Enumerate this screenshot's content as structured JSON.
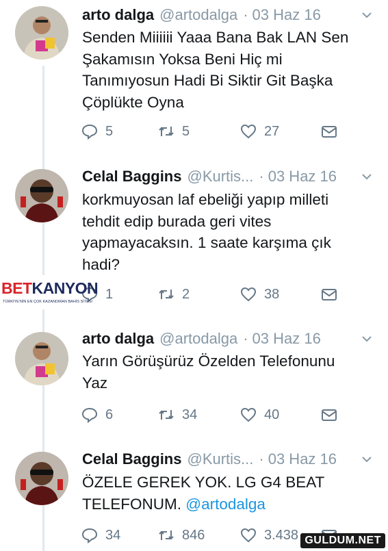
{
  "tweets": [
    {
      "name": "arto dalga",
      "handle": "@artodalga",
      "date": "03 Haz 16",
      "text_lines": [
        "Senden Miiiiii Yaaa Bana Bak LAN Sen",
        "Şakamısın Yoksa Beni Hiç mi",
        "Tanımıyosun Hadi Bi Siktir Git Başka",
        "Çöplükte Oyna"
      ],
      "replies": "5",
      "retweets": "5",
      "likes": "27"
    },
    {
      "name": "Celal Baggins",
      "handle": "@Kurtis...",
      "date": "03 Haz 16",
      "text_lines": [
        "korkmuyosan laf ebeliği yapıp milleti",
        "tehdit edip burada geri vites",
        "yapmayacaksın. 1 saate karşıma çık",
        "hadi?"
      ],
      "replies": "1",
      "retweets": "2",
      "likes": "38"
    },
    {
      "name": "arto dalga",
      "handle": "@artodalga",
      "date": "03 Haz 16",
      "text_lines": [
        "Yarın Görüşürüz Özelden Telefonunu",
        "Yaz"
      ],
      "replies": "6",
      "retweets": "34",
      "likes": "40"
    },
    {
      "name": "Celal Baggins",
      "handle": "@Kurtis...",
      "date": "03 Haz 16",
      "text_lines": [
        "ÖZELE GEREK YOK. LG G4 BEAT"
      ],
      "text_line2": "TELEFONUM.",
      "mention": "@artodalga",
      "replies": "34",
      "retweets": "846",
      "likes": "3.438"
    }
  ],
  "ad_logo": {
    "bet": "BET",
    "kanyon": "KANYON",
    "tagline": "TÜRKİYE'NİN EN ÇOK KAZANDIRAN BAHİS SİTESİ"
  },
  "watermark": "GULDUM.NET",
  "icons": {
    "reply": "reply-icon",
    "retweet": "retweet-icon",
    "like": "heart-icon",
    "dm": "envelope-icon",
    "menu": "chevron-down-icon"
  },
  "colors": {
    "muted": "#8899a6",
    "mention": "#1b95e0",
    "text": "#14171a"
  }
}
